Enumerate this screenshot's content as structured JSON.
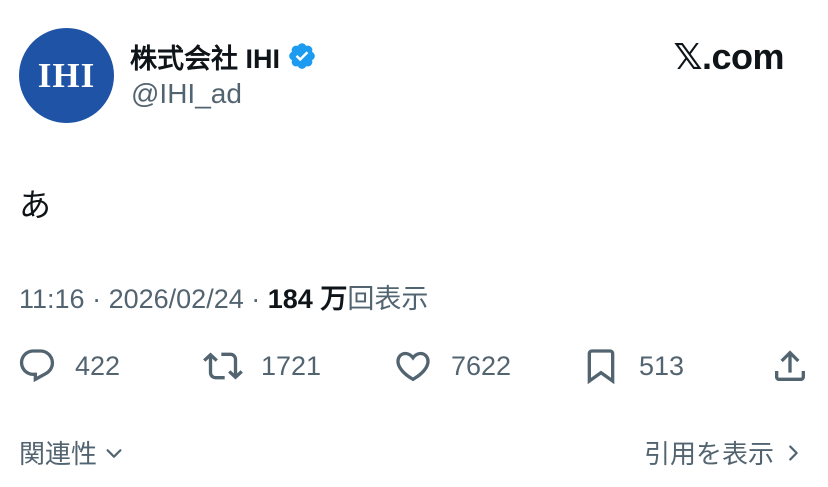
{
  "author": {
    "avatar_text": "IHI",
    "display_name": "株式会社 IHI",
    "handle": "@IHI_ad",
    "verified_icon": "verified-badge-icon"
  },
  "brand": "𝕏.com",
  "tweet": {
    "text": "あ",
    "time": "11:16",
    "separator": "·",
    "date": "2026/02/24",
    "views_count": "184 万",
    "views_label": "回表示"
  },
  "actions": {
    "reply": {
      "icon": "reply-icon",
      "count": "422"
    },
    "retweet": {
      "icon": "retweet-icon",
      "count": "1721"
    },
    "like": {
      "icon": "heart-icon",
      "count": "7622"
    },
    "bookmark": {
      "icon": "bookmark-icon",
      "count": "513"
    },
    "share": {
      "icon": "share-icon"
    }
  },
  "footer": {
    "related_label": "関連性",
    "related_icon": "chevron-down-icon",
    "quotes_label": "引用を表示",
    "quotes_icon": "chevron-right-icon"
  },
  "colors": {
    "avatar_bg": "#1f53a6",
    "verified": "#1d9bf0",
    "text_primary": "#0f1419",
    "text_secondary": "#536471"
  }
}
